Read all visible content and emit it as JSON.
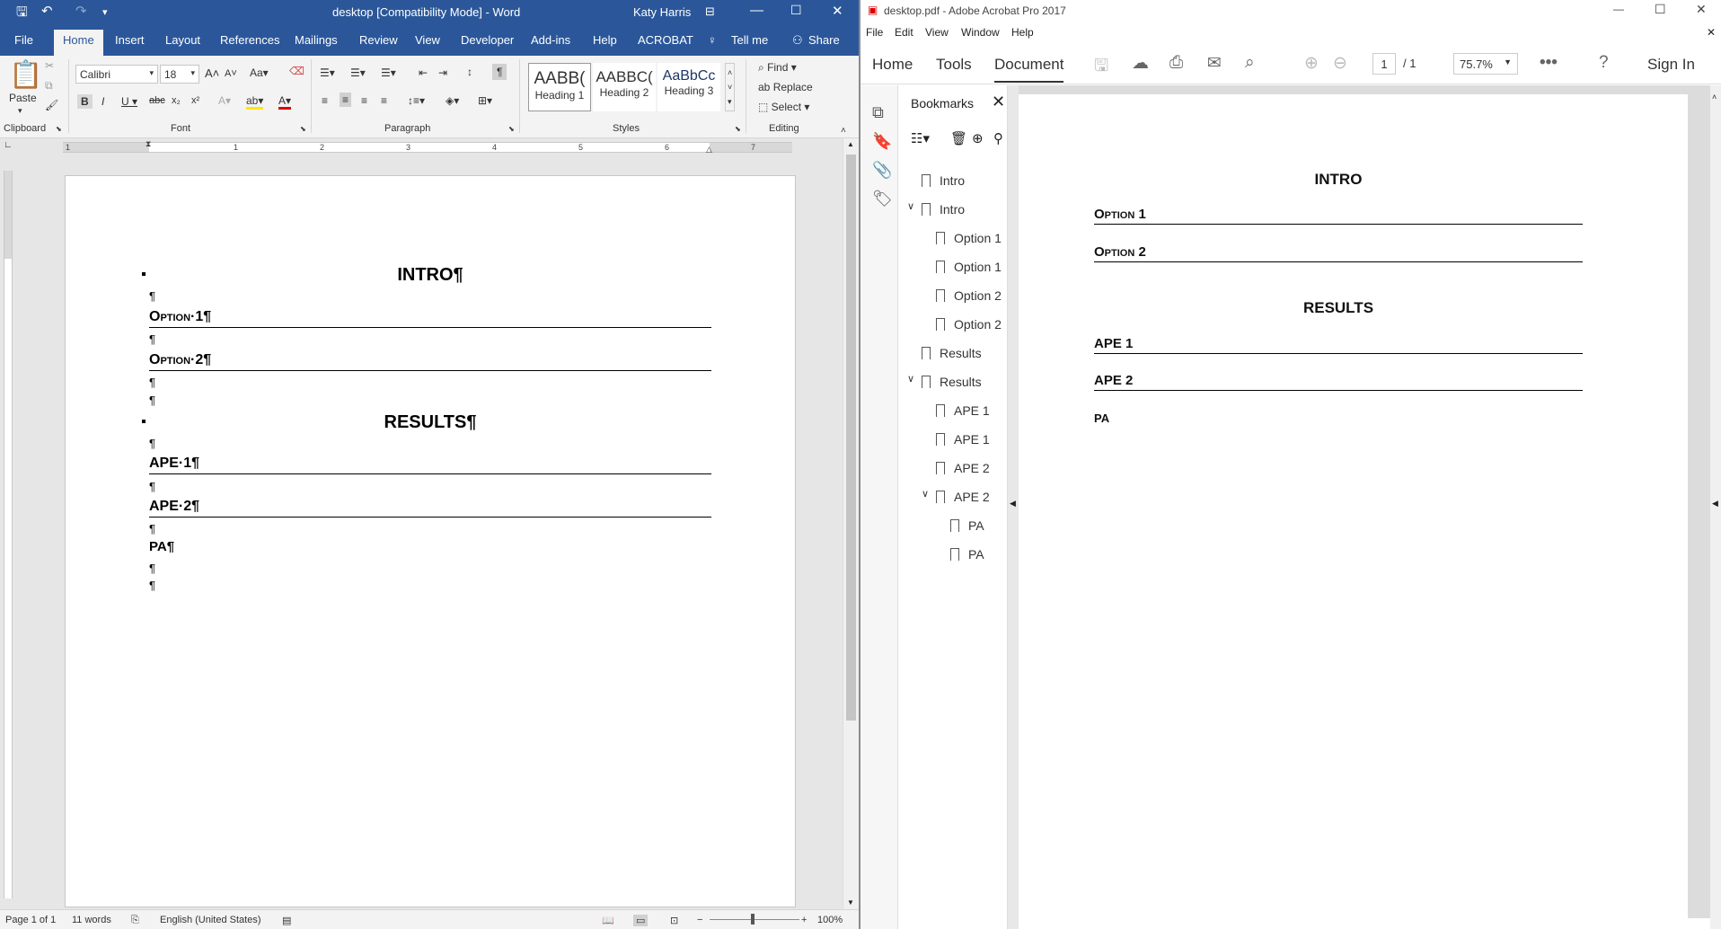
{
  "word": {
    "title": "desktop [Compatibility Mode] - Word",
    "user": "Katy Harris",
    "tabs": [
      "File",
      "Home",
      "Insert",
      "Layout",
      "References",
      "Mailings",
      "Review",
      "View",
      "Developer",
      "Add-ins",
      "Help",
      "ACROBAT",
      "Tell me",
      "Share"
    ],
    "clipboard": {
      "paste": "Paste",
      "group": "Clipboard"
    },
    "font": {
      "name": "Calibri",
      "size": "18",
      "group": "Font"
    },
    "paragraph_group": "Paragraph",
    "styles": {
      "group": "Styles",
      "items": [
        {
          "preview": "AABB(",
          "label": "Heading 1"
        },
        {
          "preview": "AABBC(",
          "label": "Heading 2"
        },
        {
          "preview": "AaBbCc",
          "label": "Heading 3"
        }
      ]
    },
    "editing": {
      "group": "Editing",
      "find": "Find",
      "replace": "Replace",
      "select": "Select"
    },
    "ruler_numbers": [
      "1",
      "1",
      "2",
      "3",
      "4",
      "5",
      "6",
      "7"
    ],
    "doc": {
      "intro": "INTRO¶",
      "pmark": "¶",
      "option1": "Option·1¶",
      "option2": "Option·2¶",
      "results": "RESULTS¶",
      "ape1": "APE·1¶",
      "ape2": "APE·2¶",
      "pa": "PA¶"
    },
    "status": {
      "page": "Page 1 of 1",
      "words": "11 words",
      "lang": "English (United States)",
      "zoom": "100%"
    }
  },
  "acrobat": {
    "title": "desktop.pdf - Adobe Acrobat Pro 2017",
    "menu": [
      "File",
      "Edit",
      "View",
      "Window",
      "Help"
    ],
    "nav": {
      "home": "Home",
      "tools": "Tools",
      "document": "Document",
      "signin": "Sign In"
    },
    "page_current": "1",
    "page_total": "/ 1",
    "zoom": "75.7%",
    "bookmarks_title": "Bookmarks",
    "bookmarks": [
      "Intro",
      "Intro",
      "Option 1",
      "Option 1",
      "Option 2",
      "Option 2",
      "Results",
      "Results",
      "APE 1",
      "APE 1",
      "APE 2",
      "APE 2",
      "PA",
      "PA"
    ],
    "pdf": {
      "intro": "INTRO",
      "option1": "Option 1",
      "option2": "Option 2",
      "results": "RESULTS",
      "ape1": "APE 1",
      "ape2": "APE 2",
      "pa": "PA"
    }
  }
}
